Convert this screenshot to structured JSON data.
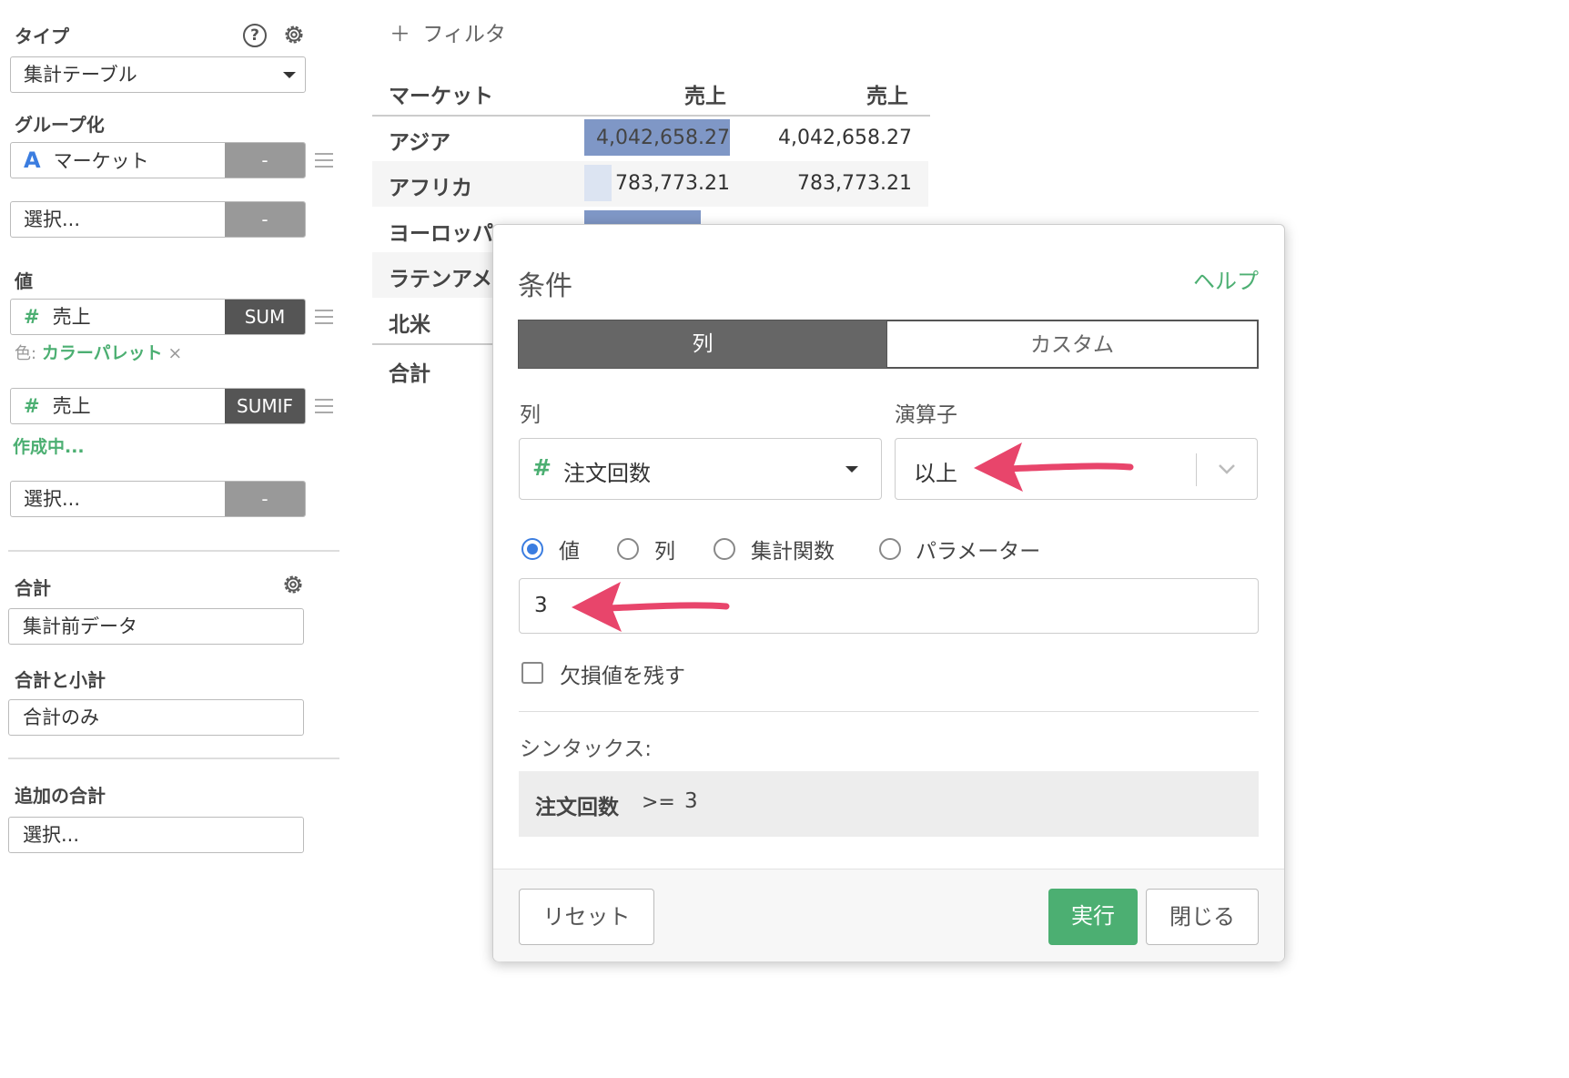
{
  "left_panel": {
    "type": {
      "label": "タイプ",
      "value": "集計テーブル"
    },
    "grouping": {
      "label": "グループ化",
      "fields": [
        {
          "symbol": "A",
          "name": "マーケット",
          "action": "-"
        }
      ],
      "select_placeholder": "選択...",
      "select_action": "-"
    },
    "values": {
      "label": "値",
      "fields": [
        {
          "symbol": "#",
          "name": "売上",
          "agg": "SUM",
          "color_prefix": "色:",
          "color_value": "カラーパレット",
          "color_remove": "×"
        },
        {
          "symbol": "#",
          "name": "売上",
          "agg": "SUMIF",
          "status": "作成中..."
        }
      ],
      "select_placeholder": "選択...",
      "select_action": "-"
    },
    "total": {
      "label": "合計",
      "value": "集計前データ"
    },
    "total_subtotal": {
      "label": "合計と小計",
      "value": "合計のみ"
    },
    "additional_total": {
      "label": "追加の合計",
      "placeholder": "選択..."
    }
  },
  "filter": {
    "plus": "＋",
    "label": "フィルタ"
  },
  "table": {
    "headers": [
      "マーケット",
      "売上",
      "売上"
    ],
    "rows": [
      {
        "market": "アジア",
        "v1": "4,042,658.27",
        "v2": "4,042,658.27",
        "bar": 1.0
      },
      {
        "market": "アフリカ",
        "v1": "783,773.21",
        "v2": "783,773.21",
        "bar": 0.19
      },
      {
        "market": "ヨーロッパ",
        "v1": "",
        "v2": "",
        "bar": 0.8
      },
      {
        "market": "ラテンアメリカ",
        "v1": "",
        "v2": ""
      },
      {
        "market": "北米",
        "v1": "",
        "v2": ""
      }
    ],
    "total_label": "合計"
  },
  "dialog": {
    "title": "条件",
    "help": "ヘルプ",
    "tabs": [
      "列",
      "カスタム"
    ],
    "active_tab": 0,
    "column_label": "列",
    "column_symbol": "#",
    "column_value": "注文回数",
    "operator_label": "演算子",
    "operator_value": "以上",
    "radio_options": [
      "値",
      "列",
      "集計関数",
      "パラメーター"
    ],
    "radio_selected": 0,
    "value_input": "3",
    "keep_missing": "欠損値を残す",
    "keep_missing_checked": false,
    "syntax_label": "シンタックス:",
    "syntax": {
      "column": "注文回数",
      "op": ">=",
      "value": "3"
    },
    "buttons": {
      "reset": "リセット",
      "run": "実行",
      "close": "閉じる"
    }
  },
  "colors": {
    "accent_green": "#4caf72",
    "dark_button": "#555555",
    "gray_button": "#999999",
    "bar_blue": "#7f97c6",
    "arrow_red": "#e8456b",
    "radio_blue": "#3b7de0"
  }
}
